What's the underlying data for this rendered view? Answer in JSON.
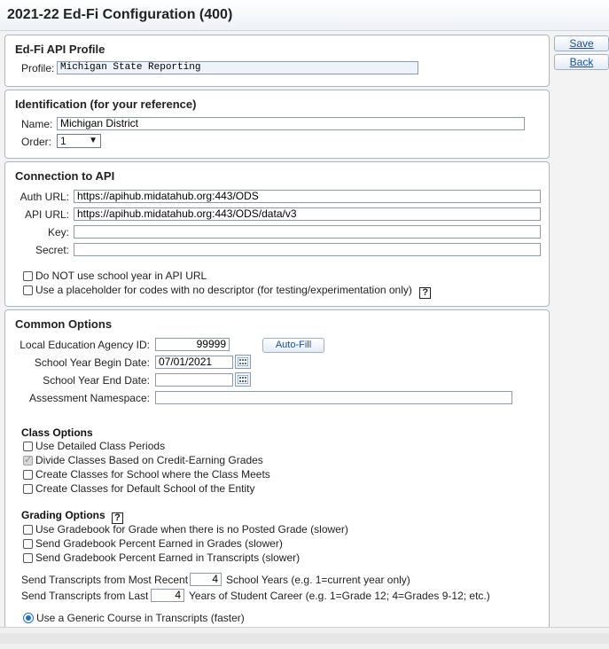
{
  "window": {
    "title": "2021-22 Ed-Fi Configuration (400)"
  },
  "actions": {
    "save": "Save",
    "back": "Back"
  },
  "api_profile": {
    "heading": "Ed-Fi API Profile",
    "profile_label": "Profile:",
    "profile_value": "Michigan State Reporting"
  },
  "identification": {
    "heading": "Identification (for your reference)",
    "name_label": "Name:",
    "name_value": "Michigan District",
    "order_label": "Order:",
    "order_value": "1"
  },
  "connection": {
    "heading": "Connection to API",
    "auth_label": "Auth URL:",
    "auth_value": "https://apihub.midatahub.org:443/ODS",
    "api_label": "API URL:",
    "api_value": "https://apihub.midatahub.org:443/ODS/data/v3",
    "key_label": "Key:",
    "key_value": "",
    "secret_label": "Secret:",
    "secret_value": "",
    "opt_no_school_year": "Do NOT use school year in API URL",
    "opt_placeholder": "Use a placeholder for codes with no descriptor (for testing/experimentation only)"
  },
  "common": {
    "heading": "Common Options",
    "lea_label": "Local Education Agency ID:",
    "lea_value": "99999",
    "autofill": "Auto-Fill",
    "begin_label": "School Year Begin Date:",
    "begin_value": "07/01/2021",
    "end_label": "School Year End Date:",
    "end_value": "",
    "ns_label": "Assessment Namespace:",
    "ns_value": ""
  },
  "class_options": {
    "heading": "Class Options",
    "items": [
      {
        "label": "Use Detailed Class Periods",
        "checked": false,
        "disabled": false
      },
      {
        "label": "Divide Classes Based on Credit-Earning Grades",
        "checked": true,
        "disabled": true
      },
      {
        "label": "Create Classes for School where the Class Meets",
        "checked": false,
        "disabled": false
      },
      {
        "label": "Create Classes for Default School of the Entity",
        "checked": false,
        "disabled": false
      }
    ]
  },
  "grading_options": {
    "heading": "Grading Options",
    "items": [
      {
        "label": "Use Gradebook for Grade when there is no Posted Grade (slower)"
      },
      {
        "label": "Send Gradebook Percent Earned in Grades (slower)"
      },
      {
        "label": "Send Gradebook Percent Earned in Transcripts (slower)"
      }
    ]
  },
  "transcripts": {
    "recent_prefix": "Send Transcripts from Most Recent",
    "recent_value": "4",
    "recent_suffix": "School Years (e.g. 1=current year only)",
    "last_prefix": "Send Transcripts from Last",
    "last_value": "4",
    "last_suffix": "Years of Student Career (e.g. 1=Grade 12; 4=Grades 9-12; etc.)",
    "generic_course": "Use a Generic Course in Transcripts (faster)"
  }
}
